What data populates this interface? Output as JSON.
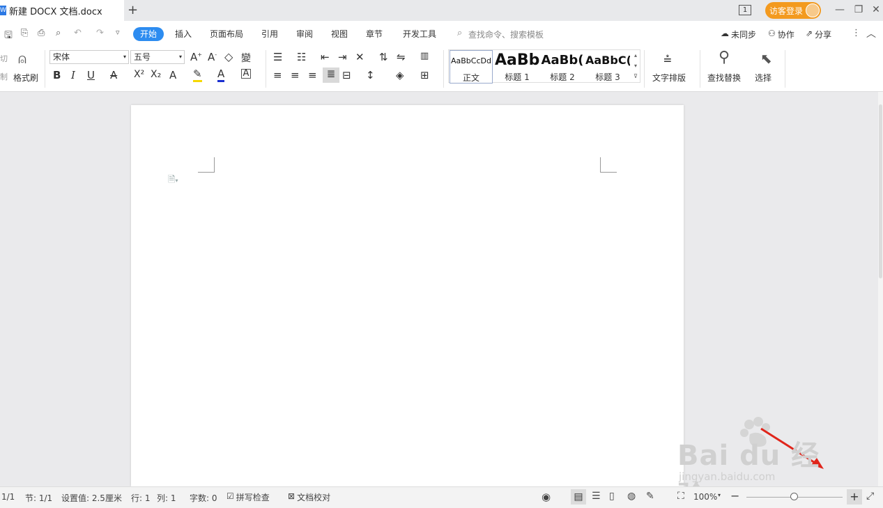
{
  "titlebar": {
    "doc_icon": "W",
    "doc_title": "新建 DOCX 文档.docx",
    "new_tab": "+",
    "page_badge": "1",
    "login": "访客登录",
    "minimize": "—",
    "restore": "❐",
    "close": "✕"
  },
  "menubar": {
    "items": [
      "开始",
      "插入",
      "页面布局",
      "引用",
      "审阅",
      "视图",
      "章节",
      "开发工具"
    ],
    "search_placeholder": "查找命令、搜索模板",
    "sync": "未同步",
    "collab": "协作",
    "share": "分享"
  },
  "ribbon": {
    "cut_partial": "切",
    "copy_partial": "制",
    "format_painter": "格式刷",
    "font_name": "宋体",
    "font_size": "五号",
    "styles": [
      {
        "preview": "AaBbCcDd",
        "label": "正文"
      },
      {
        "preview": "AaBb",
        "label": "标题 1"
      },
      {
        "preview": "AaBb(",
        "label": "标题 2"
      },
      {
        "preview": "AaBbC(",
        "label": "标题 3"
      }
    ],
    "text_layout": "文字排版",
    "find_replace": "查找替换",
    "select": "选择"
  },
  "statusbar": {
    "page": "1/1",
    "section": "节: 1/1",
    "setting": "设置值: 2.5厘米",
    "row": "行: 1",
    "col": "列: 1",
    "wordcount": "字数: 0",
    "spellcheck": "拼写检查",
    "proofread": "文档校对",
    "zoom": "100%"
  },
  "watermark": {
    "brand": "Bai du 经验",
    "url": "jingyan.baidu.com"
  },
  "colors": {
    "accent": "#2d8cf0",
    "login": "#f39a1f",
    "arrow": "#e0251b"
  }
}
